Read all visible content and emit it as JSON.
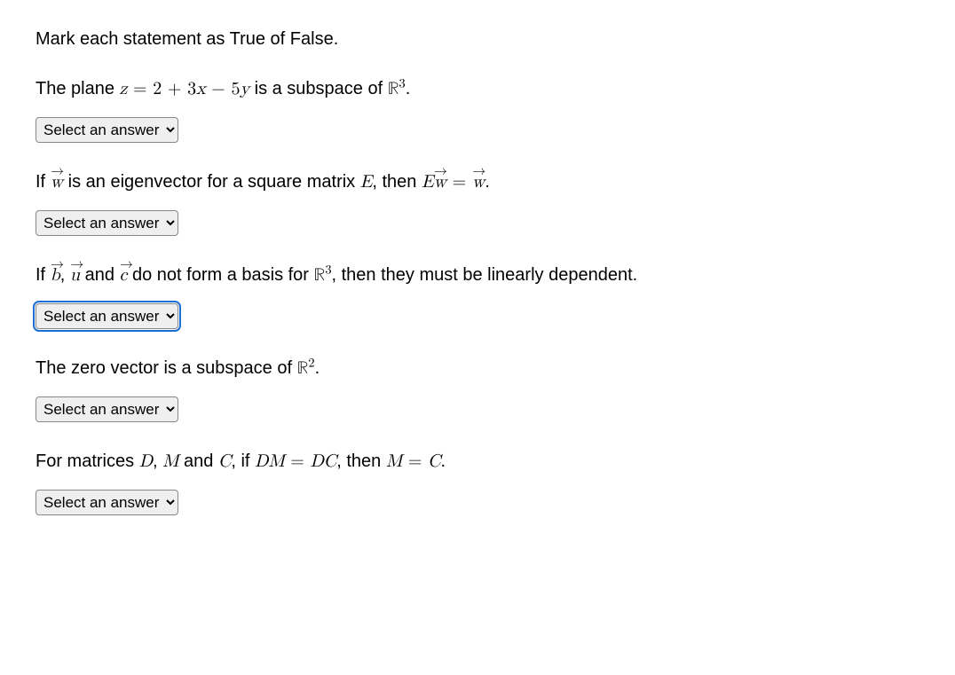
{
  "intro": "Mark each statement as True of False.",
  "select_placeholder": "Select an answer",
  "questions": {
    "q1": {
      "prefix": "The plane ",
      "eq_lhs_var": "z",
      "eq_eq": " = ",
      "eq_rhs": "2 + 3",
      "eq_x": "x",
      "eq_minus": " − 5",
      "eq_y": "y",
      "mid": " is a subspace of ",
      "space": "ℝ",
      "exp": "3",
      "end": "."
    },
    "q2": {
      "prefix": "If ",
      "w1": "w",
      "mid1": " is an eigenvector for a square matrix ",
      "E": "E",
      "mid2": ", then ",
      "E2": "E",
      "w2": "w",
      "eq": " = ",
      "w3": "w",
      "end": "."
    },
    "q3": {
      "prefix": "If ",
      "b": "b",
      "sep1": ", ",
      "u": "u",
      "and": " and ",
      "c": "c",
      "mid": " do not form a basis for ",
      "space": "ℝ",
      "exp": "3",
      "end": ", then they must be linearly dependent."
    },
    "q4": {
      "prefix": "The zero vector is a subspace of ",
      "space": "ℝ",
      "exp": "2",
      "end": "."
    },
    "q5": {
      "prefix": "For matrices ",
      "D": "D",
      "sep1": ", ",
      "M": "M",
      "and": " and ",
      "C": "C",
      "mid": ", if ",
      "DM_D": "D",
      "DM_M": "M",
      "eq1": " = ",
      "DC_D": "D",
      "DC_C": "C",
      "then": ", then ",
      "M2": "M",
      "eq2": " = ",
      "C2": "C",
      "end": "."
    }
  }
}
